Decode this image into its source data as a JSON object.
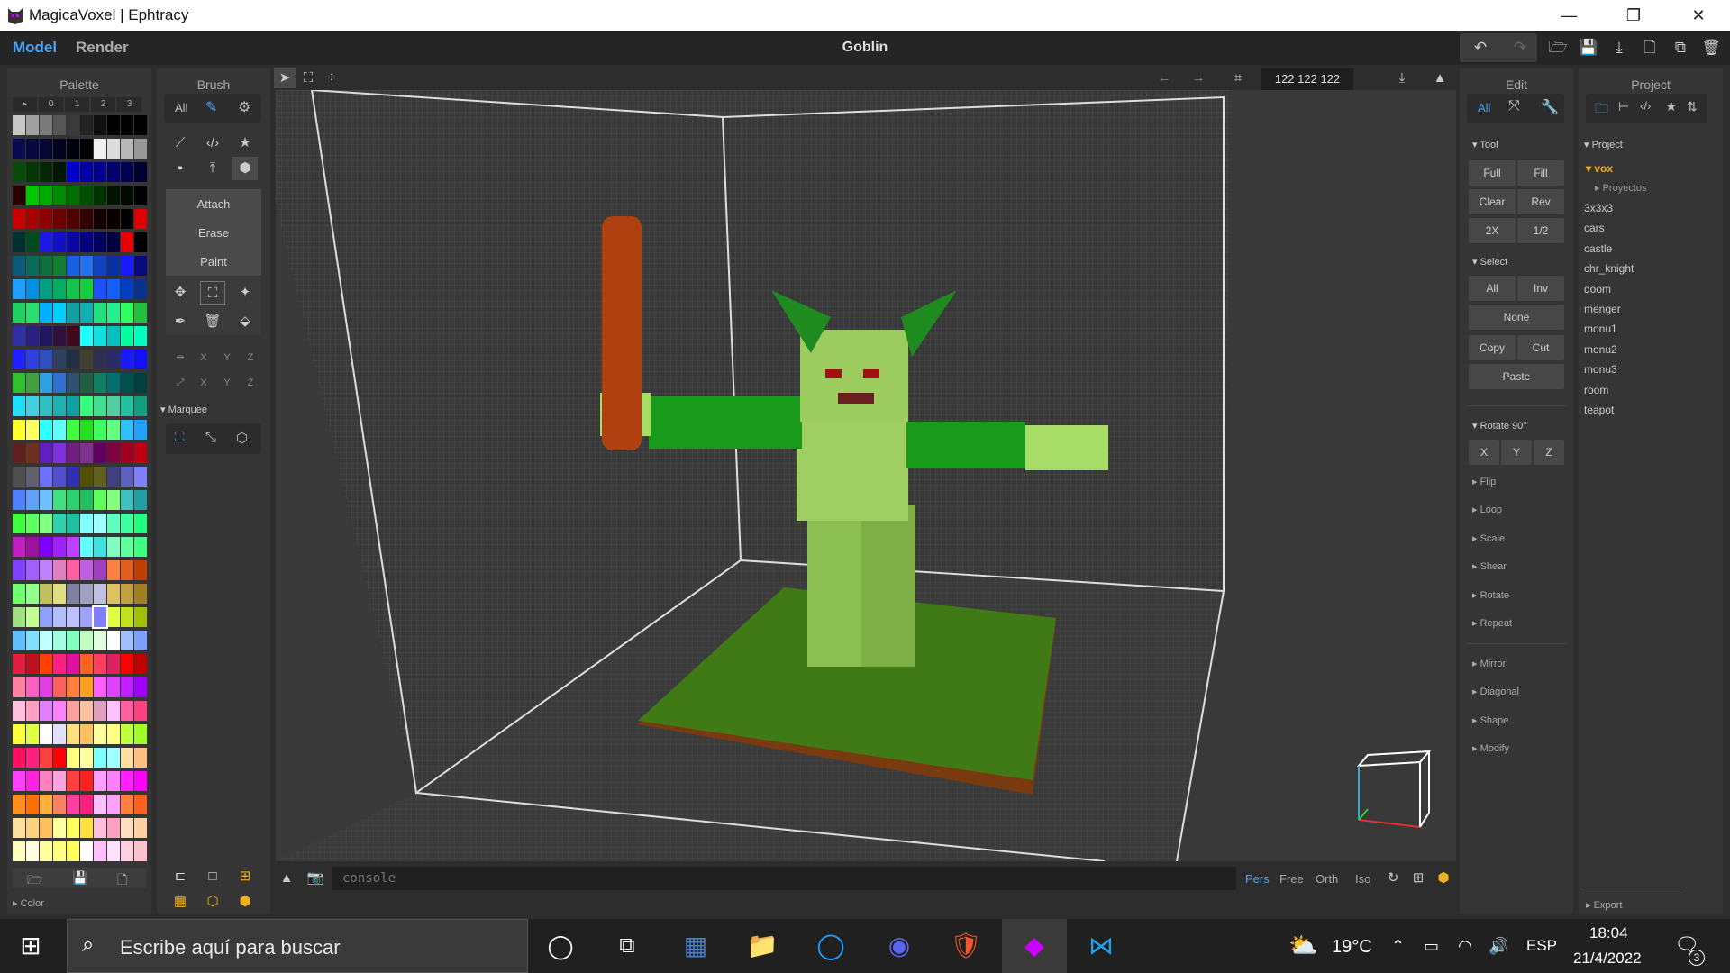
{
  "window": {
    "title": "MagicaVoxel | Ephtracy",
    "minimize": "—",
    "maximize": "❐",
    "close": "✕"
  },
  "menu": {
    "model": "Model",
    "render": "Render",
    "document": "Goblin"
  },
  "palette": {
    "header": "Palette",
    "pages": [
      "▸",
      "0",
      "1",
      "2",
      "3"
    ],
    "color_label": "Color",
    "rows": [
      [
        "#c8c8c8",
        "#a0a0a0",
        "#7a7a7a",
        "#575757",
        "#3a3a3a",
        "#222222",
        "#101010",
        "#000000",
        "#000000",
        "#000000"
      ],
      [
        "#0a0a50",
        "#080840",
        "#060630",
        "#040420",
        "#02020e",
        "#000000",
        "#f0f0f0",
        "#dcdcdc",
        "#b8b8b8",
        "#989898"
      ],
      [
        "#0a4a0a",
        "#063806",
        "#042604",
        "#021402",
        "#0000c8",
        "#0000aa",
        "#00008c",
        "#00006e",
        "#000050",
        "#000032"
      ],
      [
        "#280000",
        "#00c800",
        "#00aa00",
        "#008c00",
        "#006e00",
        "#005000",
        "#003200",
        "#001400",
        "#000a00",
        "#000000"
      ],
      [
        "#c80000",
        "#aa0000",
        "#8c0000",
        "#6e0000",
        "#500000",
        "#320000",
        "#140000",
        "#0a0000",
        "#000000",
        "#e00000"
      ],
      [
        "#003030",
        "#004c20",
        "#1a1ae0",
        "#1010c8",
        "#0808a0",
        "#000080",
        "#000060",
        "#000040",
        "#e80000",
        "#000000"
      ],
      [
        "#0c5a7a",
        "#0c6a5a",
        "#107040",
        "#108030",
        "#1860e0",
        "#2070f0",
        "#1044c0",
        "#0830a0",
        "#1a1aff",
        "#0a0a80"
      ],
      [
        "#20a0ff",
        "#0090e0",
        "#00a080",
        "#00b060",
        "#18c050",
        "#10d040",
        "#2050ff",
        "#1060ff",
        "#0040c0",
        "#0a3090"
      ],
      [
        "#20d060",
        "#28e070",
        "#00b0ff",
        "#00d0ff",
        "#10a0a0",
        "#10b0b0",
        "#20e080",
        "#20f090",
        "#30ff60",
        "#20c040"
      ],
      [
        "#3030a0",
        "#282080",
        "#201860",
        "#301040",
        "#400820",
        "#20ffff",
        "#10e0e0",
        "#00c0c0",
        "#00ffa0",
        "#00ffc0"
      ],
      [
        "#2020ff",
        "#3040e0",
        "#3050c0",
        "#304060",
        "#203040",
        "#404030",
        "#303050",
        "#2a2a6a",
        "#1a1aff",
        "#1010ff"
      ],
      [
        "#30c030",
        "#40a040",
        "#30a0e0",
        "#3070d0",
        "#305070",
        "#206040",
        "#108060",
        "#007070",
        "#005050",
        "#004040"
      ],
      [
        "#20e0ff",
        "#40d0e0",
        "#30c0c0",
        "#20b0b0",
        "#10a0a0",
        "#30ff80",
        "#40e090",
        "#50d0a0",
        "#20c0a0",
        "#10a080"
      ],
      [
        "#ffff30",
        "#ffff60",
        "#30ffff",
        "#60ffff",
        "#40ff40",
        "#20e020",
        "#40ff60",
        "#60ff80",
        "#30c0ff",
        "#20a0ff"
      ],
      [
        "#602020",
        "#703020",
        "#6020c0",
        "#8030e0",
        "#702080",
        "#803090",
        "#600060",
        "#800040",
        "#a00020",
        "#c00010"
      ],
      [
        "#505050",
        "#606070",
        "#7070ff",
        "#5050d0",
        "#3030b0",
        "#505000",
        "#606020",
        "#404080",
        "#6060c0",
        "#8080ff"
      ],
      [
        "#5080ff",
        "#60a0ff",
        "#70c0ff",
        "#40e080",
        "#30d070",
        "#20c060",
        "#60ff60",
        "#80ff80",
        "#40c0c0",
        "#20a0a0"
      ],
      [
        "#40ff40",
        "#60ff60",
        "#80ff80",
        "#30d0b0",
        "#20c0a0",
        "#80ffff",
        "#a0ffff",
        "#60ffc0",
        "#40ffa0",
        "#20ff80"
      ],
      [
        "#c020c0",
        "#a010a0",
        "#8000ff",
        "#a020ff",
        "#c040ff",
        "#60ffff",
        "#40e0e0",
        "#80ffc0",
        "#60ffa0",
        "#40ff80"
      ],
      [
        "#8040ff",
        "#a060ff",
        "#c080ff",
        "#e080c0",
        "#ff60a0",
        "#c060e0",
        "#a040c0",
        "#ff8040",
        "#e06020",
        "#c04000"
      ],
      [
        "#70ff70",
        "#90ff90",
        "#c0c060",
        "#e0e080",
        "#8080a0",
        "#a0a0c0",
        "#c0c0e0",
        "#e0c060",
        "#c0a040",
        "#a08020"
      ],
      [
        "#a0e080",
        "#c0ff90",
        "#90a0ff",
        "#b0c0ff",
        "#c0c0ff",
        "#a0a0ff",
        "#8080ff",
        "#e0ff40",
        "#c0e020",
        "#a0c000"
      ],
      [
        "#60c0ff",
        "#80e0ff",
        "#c0ffff",
        "#a0ffe0",
        "#80ffc0",
        "#c0ffc0",
        "#e0ffe0",
        "#ffffff",
        "#a0c0ff",
        "#80a0ff"
      ],
      [
        "#e02040",
        "#c01020",
        "#ff4000",
        "#ff2080",
        "#e010a0",
        "#ff6020",
        "#ff4060",
        "#e02060",
        "#ff0000",
        "#c00000"
      ],
      [
        "#ff80a0",
        "#ff60c0",
        "#e040e0",
        "#ff6060",
        "#ff8040",
        "#ffa020",
        "#ff60ff",
        "#e040ff",
        "#c020ff",
        "#a000ff"
      ],
      [
        "#ffc0e0",
        "#ffa0c0",
        "#e080ff",
        "#ff80ff",
        "#ffa0a0",
        "#ffc0a0",
        "#e0a0c0",
        "#ffc0ff",
        "#ff60a0",
        "#ff4080"
      ],
      [
        "#ffff40",
        "#e0ff40",
        "#ffffff",
        "#e0e0ff",
        "#ffe080",
        "#ffc060",
        "#ffffa0",
        "#ffff80",
        "#c0ff40",
        "#a0ff20"
      ],
      [
        "#ff1060",
        "#ff2080",
        "#ff4040",
        "#ff0000",
        "#ffff80",
        "#ffffa0",
        "#80ffff",
        "#a0ffff",
        "#ffe0a0",
        "#ffc080"
      ],
      [
        "#ff40ff",
        "#ff20e0",
        "#ff80c0",
        "#ffa0e0",
        "#ff4040",
        "#ff2020",
        "#ffa0ff",
        "#ff80ff",
        "#ff20ff",
        "#ff00ff"
      ],
      [
        "#ff9020",
        "#ff7000",
        "#ffb040",
        "#ff8060",
        "#ff40a0",
        "#ff2080",
        "#ffc0ff",
        "#ffa0ff",
        "#ff8040",
        "#ff6020"
      ],
      [
        "#ffe0a0",
        "#ffd080",
        "#ffc060",
        "#ffffa0",
        "#ffff60",
        "#ffe040",
        "#ffc0e0",
        "#ffa0c0",
        "#ffe0c0",
        "#ffd0a0"
      ],
      [
        "#ffffc0",
        "#ffffe0",
        "#ffffa0",
        "#ffff80",
        "#ffff60",
        "#ffffff",
        "#ffc0ff",
        "#ffe0ff",
        "#ffd0e0",
        "#ffc0d0"
      ]
    ]
  },
  "brush": {
    "header": "Brush",
    "filter_all": "All",
    "actions": [
      "Attach",
      "Erase",
      "Paint"
    ],
    "axes": [
      "X",
      "Y",
      "Z"
    ],
    "marquee": "Marquee"
  },
  "viewport": {
    "dims": "122 122 122",
    "console_placeholder": "console",
    "cams": [
      "Pers",
      "Free",
      "Orth",
      "Iso"
    ]
  },
  "edit": {
    "header": "Edit",
    "filter_all": "All",
    "tool_label": "Tool",
    "tool_buttons": [
      "Full",
      "Fill",
      "Clear",
      "Rev",
      "2X",
      "1/2"
    ],
    "select_label": "Select",
    "select_buttons": [
      "All",
      "Inv",
      "None",
      "Copy",
      "Cut",
      "Paste"
    ],
    "rotate_label": "Rotate 90°",
    "rotate_axes": [
      "X",
      "Y",
      "Z"
    ],
    "sections1": [
      "Flip",
      "Loop",
      "Scale",
      "Shear",
      "Rotate",
      "Repeat"
    ],
    "sections2": [
      "Mirror",
      "Diagonal",
      "Shape",
      "Modify"
    ]
  },
  "project": {
    "header": "Project",
    "tree_label": "Project",
    "folder": "vox",
    "subfolder": "Proyectos",
    "files": [
      "3x3x3",
      "cars",
      "castle",
      "chr_knight",
      "doom",
      "menger",
      "monu1",
      "monu2",
      "monu3",
      "room",
      "teapot"
    ],
    "export": "Export"
  },
  "taskbar": {
    "search_placeholder": "Escribe aquí para buscar",
    "weather": "19°C",
    "lang": "ESP",
    "time": "18:04",
    "date": "21/4/2022",
    "notifications": "3"
  }
}
